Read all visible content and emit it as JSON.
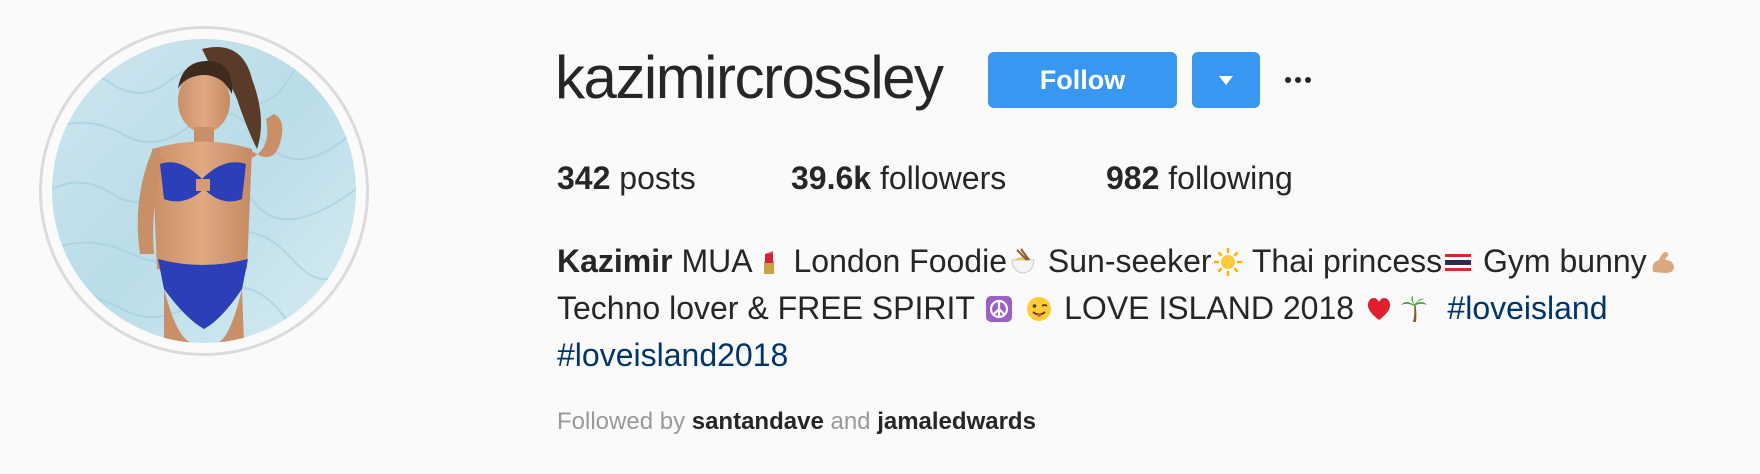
{
  "profile": {
    "username": "kazimircrossley",
    "follow_label": "Follow",
    "avatar_alt": "profile-photo"
  },
  "stats": {
    "posts_count": "342",
    "posts_label": "posts",
    "followers_count": "39.6k",
    "followers_label": "followers",
    "following_count": "982",
    "following_label": "following"
  },
  "bio": {
    "name": "Kazimir",
    "seg1": " MUA",
    "seg2": " London Foodie",
    "seg3": " Sun-seeker",
    "seg4": " Thai princess",
    "seg5": " Gym bunny",
    "seg6": "Techno lover & FREE SPIRIT ",
    "seg7": "  LOVE ISLAND 2018 ",
    "hashtag1": "#loveisland",
    "hashtag2": "#loveisland2018",
    "emojis": [
      "lipstick",
      "noodle-bowl",
      "sun",
      "thai-flag",
      "flexed-biceps",
      "peace-symbol",
      "winking-tongue-face",
      "red-heart",
      "palm-tree"
    ]
  },
  "followed_by": {
    "prefix": "Followed by ",
    "user1": "santandave",
    "connector": " and ",
    "user2": "jamaledwards"
  },
  "colors": {
    "accent": "#3897f0",
    "hashtag": "#003569",
    "text": "#262626",
    "muted": "#999999",
    "background": "#fafafa"
  }
}
